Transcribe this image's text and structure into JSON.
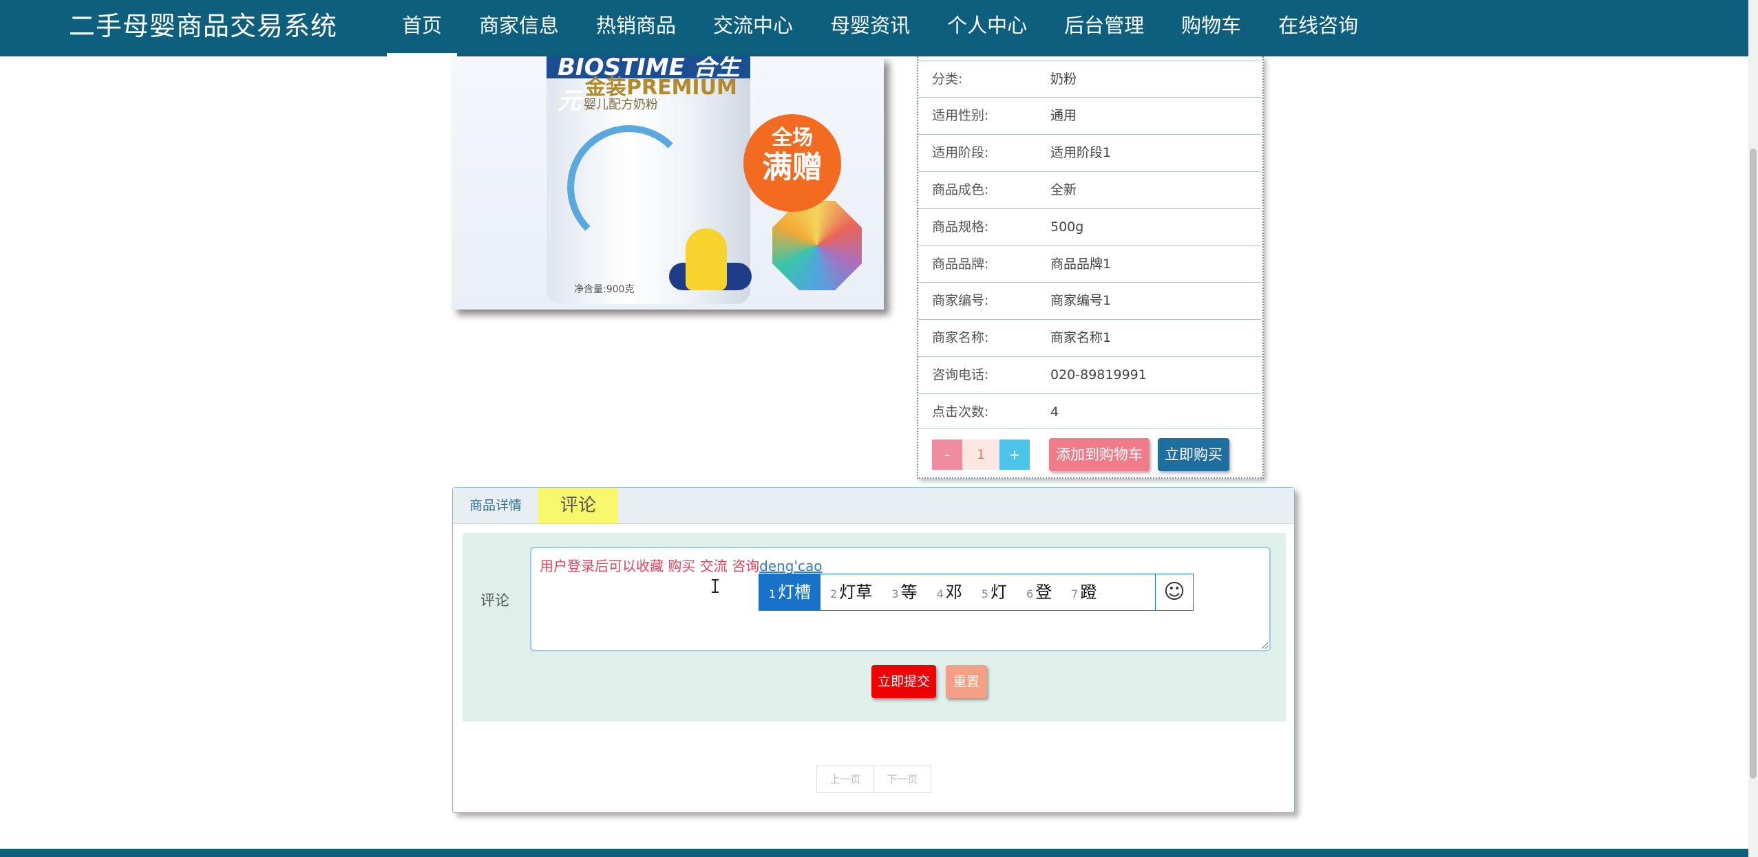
{
  "header": {
    "brand": "二手母婴商品交易系统",
    "nav": [
      "首页",
      "商家信息",
      "热销商品",
      "交流中心",
      "母婴资讯",
      "个人中心",
      "后台管理",
      "购物车",
      "在线咨询"
    ],
    "active_index": 0
  },
  "product_image": {
    "brand_text": "BIOSTIME 合生元",
    "gold_text": "金装PREMIUM",
    "sub_text": "婴儿配方奶粉",
    "net_weight": "净含量:900克",
    "promo_top": "全场",
    "promo_bottom": "满赠"
  },
  "details": {
    "rows": [
      {
        "label": "分类:",
        "value": "奶粉"
      },
      {
        "label": "适用性别:",
        "value": "通用"
      },
      {
        "label": "适用阶段:",
        "value": "适用阶段1"
      },
      {
        "label": "商品成色:",
        "value": "全新"
      },
      {
        "label": "商品规格:",
        "value": "500g"
      },
      {
        "label": "商品品牌:",
        "value": "商品品牌1"
      },
      {
        "label": "商家编号:",
        "value": "商家编号1"
      },
      {
        "label": "商家名称:",
        "value": "商家名称1"
      },
      {
        "label": "咨询电话:",
        "value": "020-89819991"
      },
      {
        "label": "点击次数:",
        "value": "4"
      }
    ],
    "qty_minus": "-",
    "qty_value": "1",
    "qty_plus": "+",
    "add_to_cart": "添加到购物车",
    "buy_now": "立即购买"
  },
  "tabs": {
    "detail": "商品详情",
    "comment": "评论",
    "active": "comment"
  },
  "comment_form": {
    "label": "评论",
    "text": "用户登录后可以收藏  购买 交流 咨询",
    "ime_composition": "deng'cao",
    "submit": "立即提交",
    "reset": "重置"
  },
  "ime": {
    "candidates": [
      {
        "num": "1",
        "text": "灯槽",
        "selected": true
      },
      {
        "num": "2",
        "text": "灯草"
      },
      {
        "num": "3",
        "text": "等"
      },
      {
        "num": "4",
        "text": "邓"
      },
      {
        "num": "5",
        "text": "灯"
      },
      {
        "num": "6",
        "text": "登"
      },
      {
        "num": "7",
        "text": "蹬"
      }
    ],
    "emoji": "☺"
  },
  "pager": {
    "prev": "上一页",
    "next": "下一页"
  },
  "colors": {
    "nav_bg": "#0e5e7e",
    "submit": "#ee0000",
    "reset": "#f5a086",
    "cart": "#f07c8a",
    "buy": "#1e6f9f",
    "ime_accent": "#1872c9"
  }
}
